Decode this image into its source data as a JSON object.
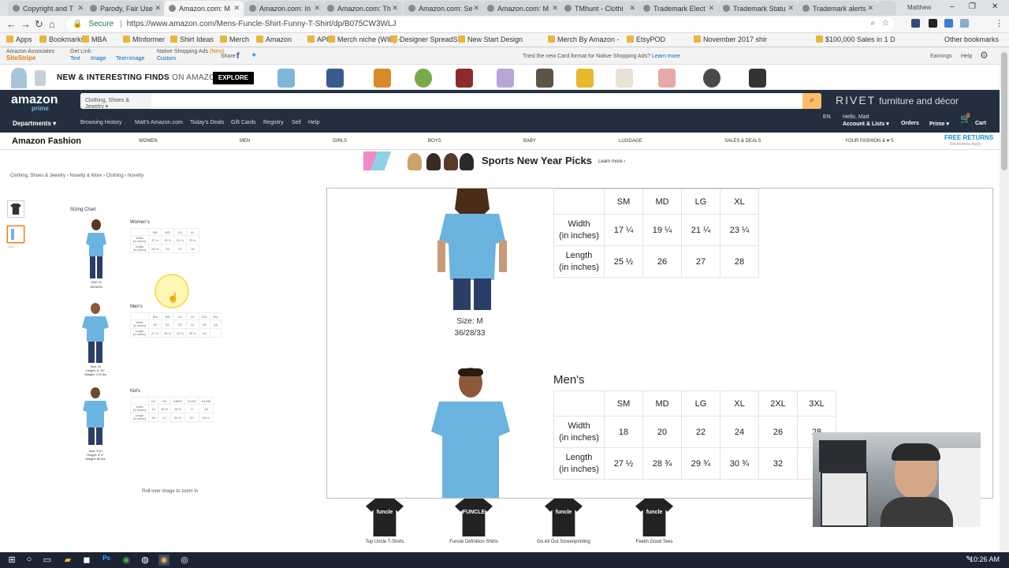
{
  "browser": {
    "tabs": [
      {
        "label": "Copyright and T"
      },
      {
        "label": "Parody, Fair Use"
      },
      {
        "label": "Amazon.com: M"
      },
      {
        "label": "Amazon.com: In"
      },
      {
        "label": "Amazon.com: Th"
      },
      {
        "label": "Amazon.com: Se"
      },
      {
        "label": "Amazon.com: M"
      },
      {
        "label": "TMhunt - Clothi"
      },
      {
        "label": "Trademark Elect"
      },
      {
        "label": "Trademark Statu"
      },
      {
        "label": "Trademark alerts"
      }
    ],
    "profile": "Matthew",
    "secure_label": "Secure",
    "url": "https://www.amazon.com/Mens-Funcle-Shirt-Funny-T-Shirt/dp/B075CW3WLJ",
    "bookmarks": [
      "Apps",
      "Bookmarks",
      "MBA",
      "MInformer",
      "Shirt Ideas",
      "Merch",
      "Amazon",
      "APC",
      "Merch niche (WIP) -",
      "Designer SpreadShe",
      "New Start Design",
      "Merch By Amazon -",
      "EtsyPOD",
      "November 2017 shir",
      "$100,000 Sales in 1 D"
    ],
    "other_bookmarks": "Other bookmarks"
  },
  "sitestripe": {
    "brand1": "Amazon Associates",
    "brand2": "SiteStripe",
    "get_link": "Get Link:",
    "links": [
      "Text",
      "Image",
      "Text+Image"
    ],
    "native": "Native Shopping Ads",
    "native_new": "(New)",
    "custom": "Custom",
    "share": "Share:",
    "message": "Tried the new Card format for Native Shopping Ads?",
    "learn_more": "Learn more",
    "earnings": "Earnings",
    "help": "Help"
  },
  "promo": {
    "text1": "NEW & INTERESTING FINDS",
    "text2": "ON AMAZON",
    "explore": "EXPLORE"
  },
  "header": {
    "logo": "amazon",
    "prime": "prime",
    "search_category": "Clothing, Shoes & Jewelry",
    "rivet": "RIVET",
    "rivet_tag": "furniture and décor",
    "departments": "Departments",
    "nav": [
      "Browsing History",
      "Matt's Amazon.com",
      "Today's Deals",
      "Gift Cards",
      "Registry",
      "Sell",
      "Help"
    ],
    "lang": "EN",
    "hello": "Hello, Matt",
    "account": "Account & Lists",
    "orders": "Orders",
    "prime_nav": "Prime",
    "cart": "Cart",
    "cart_count": "0"
  },
  "fashion_nav": {
    "brand": "Amazon Fashion",
    "items": [
      "WOMEN",
      "MEN",
      "GIRLS",
      "BOYS",
      "BABY",
      "LUGGAGE",
      "SALES & DEALS",
      "YOUR FASHION & ♥ S"
    ],
    "free_returns": "FREE RETURNS",
    "restrictions": "Restrictions Apply"
  },
  "banner": {
    "title": "Sports New Year Picks",
    "learn_more": "Learn more ›"
  },
  "breadcrumb": "Clothing, Shoes & Jewelry › Novelty & More › Clothing › Novelty",
  "mini_chart": {
    "title": "Sizing Chart",
    "womens_label": "Women's",
    "mens_label": "Men's",
    "kids_label": "Kid's",
    "women_caption": "Size: M\n36/28/33",
    "men_caption": "Size: M\nHeight: 5' 10\"\nWeight: 170 lbs",
    "kid_caption": "Size: K10\nHeight: 4' 4\"\nWeight: 80 lbs",
    "kids_sizes": [
      "K4",
      "K6",
      "K8/K9",
      "K10/S",
      "K12/M"
    ],
    "kids_width": [
      "14",
      "15 ½",
      "16 ½",
      "17",
      "18"
    ],
    "kids_length": [
      "15",
      "17",
      "20 ½",
      "20",
      "23 ½"
    ],
    "rollover": "Roll over image to zoom in"
  },
  "women_table": {
    "sizes": [
      "SM",
      "MD",
      "LG",
      "XL"
    ],
    "width_label": "Width\n(in inches)",
    "length_label": "Length\n(in inches)",
    "width": [
      "17 ¼",
      "19 ¼",
      "21 ¼",
      "23 ¼"
    ],
    "length": [
      "25 ½",
      "26",
      "27",
      "28"
    ],
    "caption": "Size: M\n36/28/33"
  },
  "men_table": {
    "title": "Men's",
    "sizes": [
      "SM",
      "MD",
      "LG",
      "XL",
      "2XL",
      "3XL"
    ],
    "width": [
      "18",
      "20",
      "22",
      "24",
      "26",
      "28"
    ],
    "length": [
      "27 ½",
      "28 ¾",
      "29 ¾",
      "30 ¾",
      "32",
      ""
    ]
  },
  "related": [
    {
      "label": "Top Uncle T-Shirts",
      "print": "funcle"
    },
    {
      "label": "Funcle Definition Shirts",
      "print": "FUNCLE"
    },
    {
      "label": "Go All Out Screenprinting",
      "print": "funcle"
    },
    {
      "label": "Feelin Good Tees",
      "print": "funcle"
    }
  ],
  "taskbar": {
    "time": "10:26 AM"
  },
  "colors": {
    "amazon_dark": "#232f3e",
    "amazon_orange": "#febd69",
    "shirt_blue": "#6cb4e0"
  }
}
